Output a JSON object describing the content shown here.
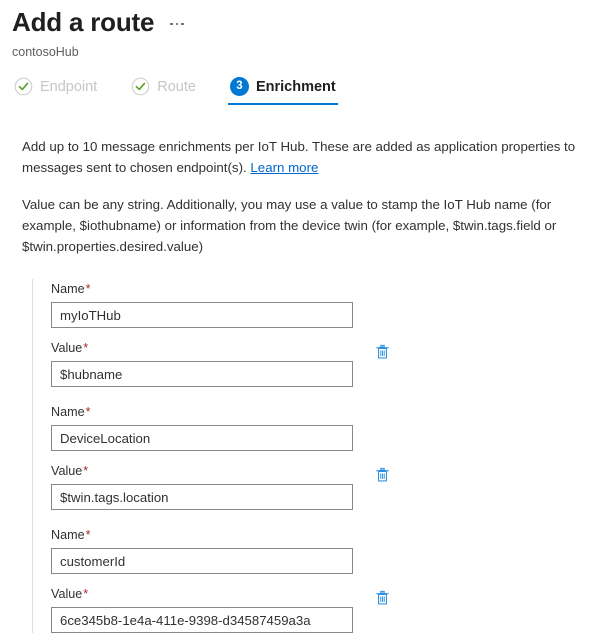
{
  "header": {
    "title": "Add a route",
    "subtitle": "contosoHub",
    "more_menu_label": "More options",
    "more_menu_icon": "ellipsis-horizontal-icon"
  },
  "tabs": [
    {
      "id": "endpoint",
      "label": "Endpoint",
      "state": "completed",
      "icon": "check-circle-icon"
    },
    {
      "id": "route",
      "label": "Route",
      "state": "completed",
      "icon": "check-circle-icon"
    },
    {
      "id": "enrichment",
      "label": "Enrichment",
      "state": "active",
      "badge": "3"
    }
  ],
  "description": {
    "paragraph1_before_link": "Add up to 10 message enrichments per IoT Hub. These are added as application properties to messages sent to chosen endpoint(s). ",
    "learn_more_label": "Learn more",
    "paragraph2": "Value can be any string. Additionally, you may use a value to stamp the IoT Hub name (for example, $iothubname) or information from the device twin (for example, $twin.tags.field or $twin.properties.desired.value)"
  },
  "form": {
    "name_label": "Name",
    "value_label": "Value",
    "required_marker": "*",
    "delete_icon": "trash-icon",
    "delete_label": "Delete enrichment",
    "enrichments": [
      {
        "name": "myIoTHub",
        "value": "$hubname"
      },
      {
        "name": "DeviceLocation",
        "value": "$twin.tags.location"
      },
      {
        "name": "customerId",
        "value": "6ce345b8-1e4a-411e-9398-d34587459a3a"
      }
    ]
  },
  "colors": {
    "accent": "#0078d4",
    "link": "#0066cc",
    "required": "#a4262c",
    "check_green": "#5ca12b",
    "disabled_text": "#c8c6c4",
    "border": "#8a8886",
    "rule": "#e1dfdd"
  }
}
